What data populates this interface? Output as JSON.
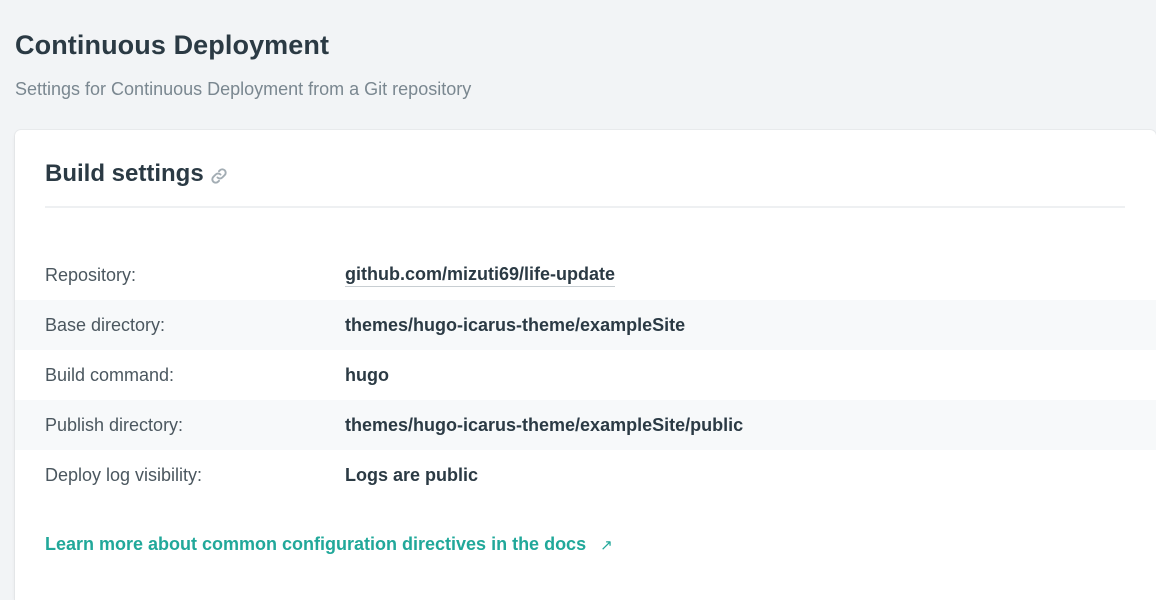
{
  "header": {
    "title": "Continuous Deployment",
    "subtitle": "Settings for Continuous Deployment from a Git repository"
  },
  "card": {
    "title": "Build settings",
    "rows": [
      {
        "label": "Repository:",
        "value": "github.com/mizuti69/life-update"
      },
      {
        "label": "Base directory:",
        "value": "themes/hugo-icarus-theme/exampleSite"
      },
      {
        "label": "Build command:",
        "value": "hugo"
      },
      {
        "label": "Publish directory:",
        "value": "themes/hugo-icarus-theme/exampleSite/public"
      },
      {
        "label": "Deploy log visibility:",
        "value": "Logs are public"
      }
    ],
    "docs_link": "Learn more about common configuration directives in the docs",
    "docs_link_icon": "external-arrow-icon"
  },
  "colors": {
    "accent": "#21a89a",
    "background": "#f2f4f6",
    "alt_row": "#f7f9fa"
  }
}
